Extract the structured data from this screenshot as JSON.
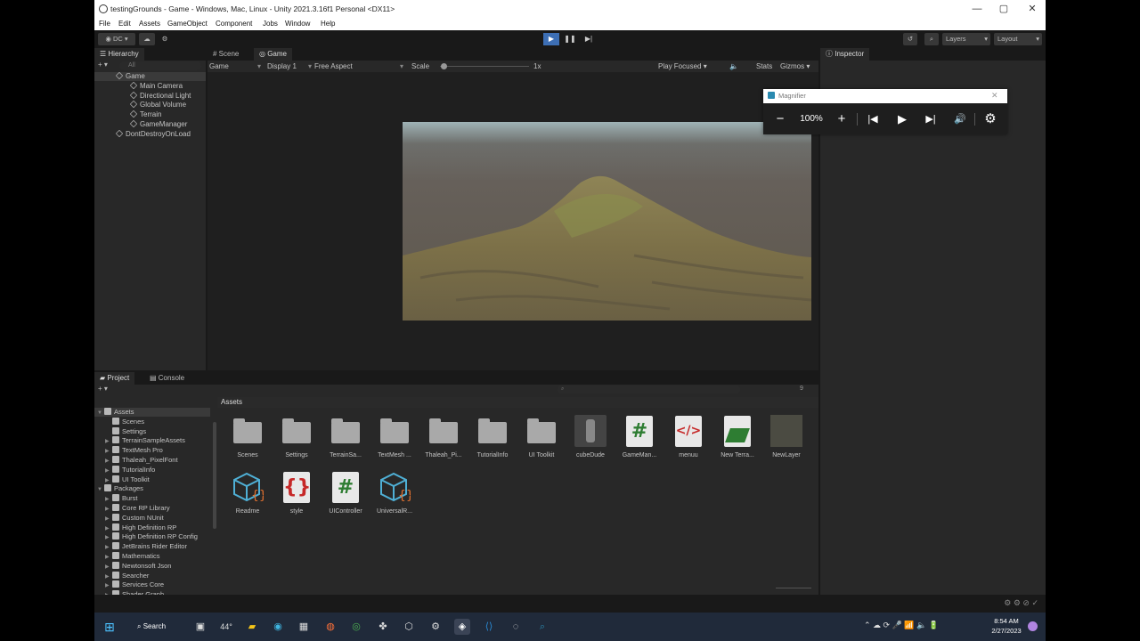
{
  "window": {
    "title": "testingGrounds - Game - Windows, Mac, Linux - Unity 2021.3.16f1 Personal <DX11>",
    "min": "—",
    "max": "▢",
    "close": "✕"
  },
  "menu": [
    "File",
    "Edit",
    "Assets",
    "GameObject",
    "Component",
    "Jobs",
    "Window",
    "Help"
  ],
  "toolbar": {
    "account": "DC",
    "layers": "Layers",
    "layout": "Layout"
  },
  "hierarchy": {
    "tab": "Hierarchy",
    "search_placeholder": "All",
    "scene": "Game",
    "children": [
      "Main Camera",
      "Directional Light",
      "Global Volume",
      "Terrain",
      "GameManager"
    ],
    "ddol": "DontDestroyOnLoad"
  },
  "scene_tab": "Scene",
  "game_tab": "Game",
  "gamebar": {
    "mode": "Game",
    "display": "Display 1",
    "aspect": "Free Aspect",
    "scale_label": "Scale",
    "scale_value": "1x",
    "play_focused": "Play Focused",
    "stats": "Stats",
    "gizmos": "Gizmos"
  },
  "inspector": {
    "tab": "Inspector"
  },
  "magnifier": {
    "title": "Magnifier",
    "zoom": "100%"
  },
  "project": {
    "tab": "Project",
    "console_tab": "Console",
    "breadcrumb": "Assets",
    "count": "9",
    "tree": [
      {
        "label": "Assets",
        "level": 0,
        "open": true,
        "sel": true
      },
      {
        "label": "Scenes",
        "level": 1
      },
      {
        "label": "Settings",
        "level": 1
      },
      {
        "label": "TerrainSampleAssets",
        "level": 1,
        "arrow": true
      },
      {
        "label": "TextMesh Pro",
        "level": 1,
        "arrow": true
      },
      {
        "label": "Thaleah_PixelFont",
        "level": 1,
        "arrow": true
      },
      {
        "label": "TutorialInfo",
        "level": 1,
        "arrow": true
      },
      {
        "label": "UI Toolkit",
        "level": 1,
        "arrow": true
      },
      {
        "label": "Packages",
        "level": 0,
        "open": true
      },
      {
        "label": "Burst",
        "level": 1,
        "arrow": true
      },
      {
        "label": "Core RP Library",
        "level": 1,
        "arrow": true
      },
      {
        "label": "Custom NUnit",
        "level": 1,
        "arrow": true
      },
      {
        "label": "High Definition RP",
        "level": 1,
        "arrow": true
      },
      {
        "label": "High Definition RP Config",
        "level": 1,
        "arrow": true
      },
      {
        "label": "JetBrains Rider Editor",
        "level": 1,
        "arrow": true
      },
      {
        "label": "Mathematics",
        "level": 1,
        "arrow": true
      },
      {
        "label": "Newtonsoft Json",
        "level": 1,
        "arrow": true
      },
      {
        "label": "Searcher",
        "level": 1,
        "arrow": true
      },
      {
        "label": "Services Core",
        "level": 1,
        "arrow": true
      },
      {
        "label": "Shader Graph",
        "level": 1,
        "arrow": true
      }
    ],
    "assets": [
      {
        "label": "Scenes",
        "kind": "folder"
      },
      {
        "label": "Settings",
        "kind": "folder"
      },
      {
        "label": "TerrainSa...",
        "kind": "folder"
      },
      {
        "label": "TextMesh ...",
        "kind": "folder"
      },
      {
        "label": "Thaleah_Pi...",
        "kind": "folder"
      },
      {
        "label": "TutorialInfo",
        "kind": "folder"
      },
      {
        "label": "UI Toolkit",
        "kind": "folder"
      },
      {
        "label": "cubeDude",
        "kind": "model"
      },
      {
        "label": "GameMan...",
        "kind": "cs"
      },
      {
        "label": "menuu",
        "kind": "uxml"
      },
      {
        "label": "New Terra...",
        "kind": "terrain"
      },
      {
        "label": "NewLayer",
        "kind": "layer"
      },
      {
        "label": "Readme",
        "kind": "readme"
      },
      {
        "label": "style",
        "kind": "uss"
      },
      {
        "label": "UIController",
        "kind": "cs"
      },
      {
        "label": "UniversalR...",
        "kind": "readme"
      }
    ]
  },
  "taskbar": {
    "search": "Search",
    "weather": "44°",
    "time": "8:54 AM",
    "date": "2/27/2023"
  }
}
